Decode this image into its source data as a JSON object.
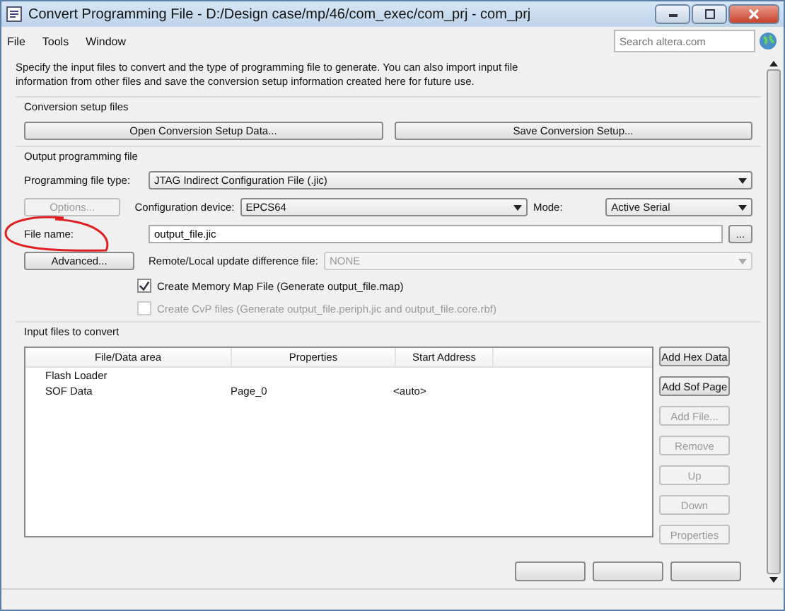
{
  "window": {
    "title": "Convert Programming File - D:/Design case/mp/46/com_exec/com_prj - com_prj"
  },
  "menu": [
    {
      "label": "File"
    },
    {
      "label": "Tools"
    },
    {
      "label": "Window"
    }
  ],
  "search": {
    "placeholder": "Search altera.com"
  },
  "intro": "Specify the input files to convert and the type of programming file to generate. You can also import input file information from other files and save the conversion setup information created here for future use.",
  "conversion_setup": {
    "title": "Conversion setup files",
    "buttons": [
      "Open Conversion Setup Data...",
      "Save Conversion Setup..."
    ]
  },
  "output": {
    "title": "Output programming file",
    "type_label": "Programming file type:",
    "type_value": "JTAG Indirect Configuration File (.jic)",
    "options_button": {
      "label": "Options...",
      "disabled": true
    },
    "device_label": "Configuration device:",
    "device_value": "EPCS64",
    "mode_label": "Mode:",
    "mode_value": "Active Serial",
    "file_label": "File name:",
    "file_value": "output_file.jic",
    "browse_button": "...",
    "advanced_button": "Advanced...",
    "diff_label": "Remote/Local update difference file:",
    "diff_value": "NONE",
    "diff_disabled": true,
    "checks": [
      {
        "label": "Create Memory Map File (Generate output_file.map)",
        "checked": true,
        "disabled": false
      },
      {
        "label": "Create CvP files (Generate output_file.periph.jic and output_file.core.rbf)",
        "checked": false,
        "disabled": true
      }
    ]
  },
  "input": {
    "title": "Input files to convert",
    "columns": [
      "File/Data area",
      "Properties",
      "Start Address"
    ],
    "rows": [
      {
        "cells": [
          "Flash Loader",
          "",
          ""
        ]
      },
      {
        "cells": [
          "SOF Data",
          "Page_0",
          "<auto>"
        ]
      }
    ],
    "buttons": [
      {
        "label": "Add Hex Data",
        "disabled": false
      },
      {
        "label": "Add Sof Page",
        "disabled": false
      },
      {
        "label": "Add File...",
        "disabled": true
      },
      {
        "label": "Remove",
        "disabled": true
      },
      {
        "label": "Up",
        "disabled": true
      },
      {
        "label": "Down",
        "disabled": true
      },
      {
        "label": "Properties",
        "disabled": true
      }
    ]
  }
}
